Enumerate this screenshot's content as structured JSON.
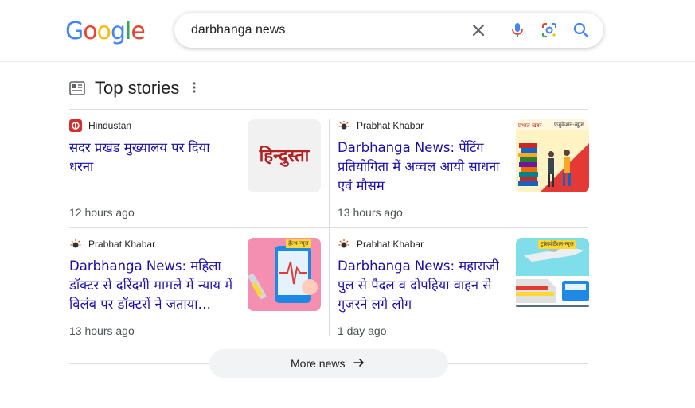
{
  "logo": {
    "text": "Google",
    "letters": [
      "G",
      "o",
      "o",
      "g",
      "l",
      "e"
    ],
    "colors": [
      "#4285f4",
      "#ea4335",
      "#fbbc05",
      "#4285f4",
      "#34a853",
      "#ea4335"
    ]
  },
  "search": {
    "query": "darbhanga news"
  },
  "top_stories": {
    "title": "Top stories",
    "stories": [
      {
        "source": "Hindustan",
        "headline": "सदर प्रखंड मुख्यालय पर दिया धरना",
        "time": "12 hours ago",
        "thumb_text": "हिन्दुस्ता"
      },
      {
        "source": "Prabhat Khabar",
        "headline": "Darbhanga News: पेंटिंग प्रतियोगिता में अव्वल आयी साधना एवं मौसम",
        "time": "13 hours ago",
        "thumb_text": "एजुकेशन-न्यूज"
      },
      {
        "source": "Prabhat Khabar",
        "headline": "Darbhanga News: महिला डॉक्टर से दरिंदगी मामले में न्याय में विलंब पर डॉक्टरों ने जताया…",
        "time": "13 hours ago",
        "thumb_text": "हेल्थ-न्यूज"
      },
      {
        "source": "Prabhat Khabar",
        "headline": "Darbhanga News: महाराजी पुल से पैदल व दोपहिया वाहन से गुजरने लगे लोग",
        "time": "1 day ago",
        "thumb_text": "ट्रांसपोर्टेशन-न्यूज"
      }
    ],
    "more_label": "More news"
  }
}
